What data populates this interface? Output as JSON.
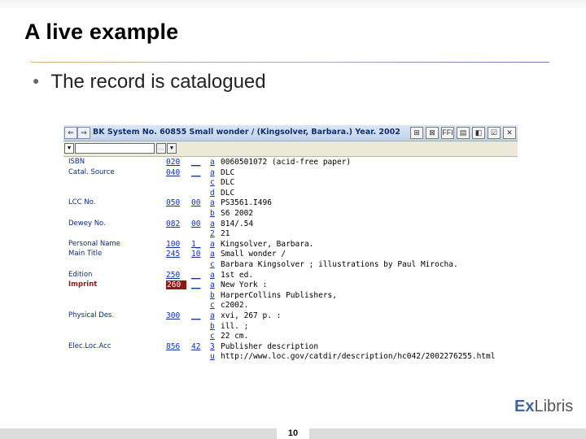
{
  "slide": {
    "title": "A live example",
    "bullet": "The record is catalogued",
    "page_number": "10",
    "logo": {
      "ex": "Ex",
      "libris": "Libris"
    }
  },
  "window": {
    "title": "BK System No. 60855 Small wonder / (Kingsolver, Barbara.) Year. 2002",
    "nav_back": "⇐",
    "nav_next": "⇒",
    "tool_icons": [
      "⊞",
      "⊠",
      "FFI",
      "▤",
      "◧",
      "☑",
      "✕"
    ],
    "toolbar": {
      "dropdown": "▼",
      "dots": "…",
      "arrow": "▼"
    }
  },
  "record": [
    {
      "label": "ISBN",
      "tag": "020",
      "ind": "__",
      "sub": "a",
      "value": "0060501072 (acid-free paper)"
    },
    {
      "label": "Catal. Source",
      "tag": "040",
      "ind": "__",
      "sub": "a",
      "value": "DLC"
    },
    {
      "label": "",
      "tag": "",
      "ind": "",
      "sub": "c",
      "value": "DLC"
    },
    {
      "label": "",
      "tag": "",
      "ind": "",
      "sub": "d",
      "value": "DLC"
    },
    {
      "label": "LCC No.",
      "tag": "050",
      "ind": "00",
      "sub": "a",
      "value": "PS3561.I496"
    },
    {
      "label": "",
      "tag": "",
      "ind": "",
      "sub": "b",
      "value": "S6 2002"
    },
    {
      "label": "Dewey No.",
      "tag": "082",
      "ind": "00",
      "sub": "a",
      "value": "814/.54"
    },
    {
      "label": "",
      "tag": "",
      "ind": "",
      "sub": "2",
      "value": "21"
    },
    {
      "label": "Personal Name",
      "tag": "100",
      "ind": "1_",
      "sub": "a",
      "value": "Kingsolver, Barbara."
    },
    {
      "label": "Main Title",
      "tag": "245",
      "ind": "10",
      "sub": "a",
      "value": "Small wonder /"
    },
    {
      "label": "",
      "tag": "",
      "ind": "",
      "sub": "c",
      "value": "Barbara Kingsolver ; illustrations by Paul Mirocha."
    },
    {
      "label": "Edition",
      "tag": "250",
      "ind": "__",
      "sub": "a",
      "value": "1st ed."
    },
    {
      "label": "Imprint",
      "tag": "260",
      "ind": "__",
      "sub": "a",
      "value": "New York :",
      "highlight": true
    },
    {
      "label": "",
      "tag": "",
      "ind": "",
      "sub": "b",
      "value": "HarperCollins Publishers,"
    },
    {
      "label": "",
      "tag": "",
      "ind": "",
      "sub": "c",
      "value": "c2002."
    },
    {
      "label": "Physical Des.",
      "tag": "300",
      "ind": "__",
      "sub": "a",
      "value": "xvi, 267 p. :"
    },
    {
      "label": "",
      "tag": "",
      "ind": "",
      "sub": "b",
      "value": "ill. ;"
    },
    {
      "label": "",
      "tag": "",
      "ind": "",
      "sub": "c",
      "value": "22 cm."
    },
    {
      "label": "Elec.Loc.Acc",
      "tag": "856",
      "ind": "42",
      "sub": "3",
      "value": "Publisher description"
    },
    {
      "label": "",
      "tag": "",
      "ind": "",
      "sub": "u",
      "value": "http://www.loc.gov/catdir/description/hc042/2002276255.html"
    }
  ]
}
